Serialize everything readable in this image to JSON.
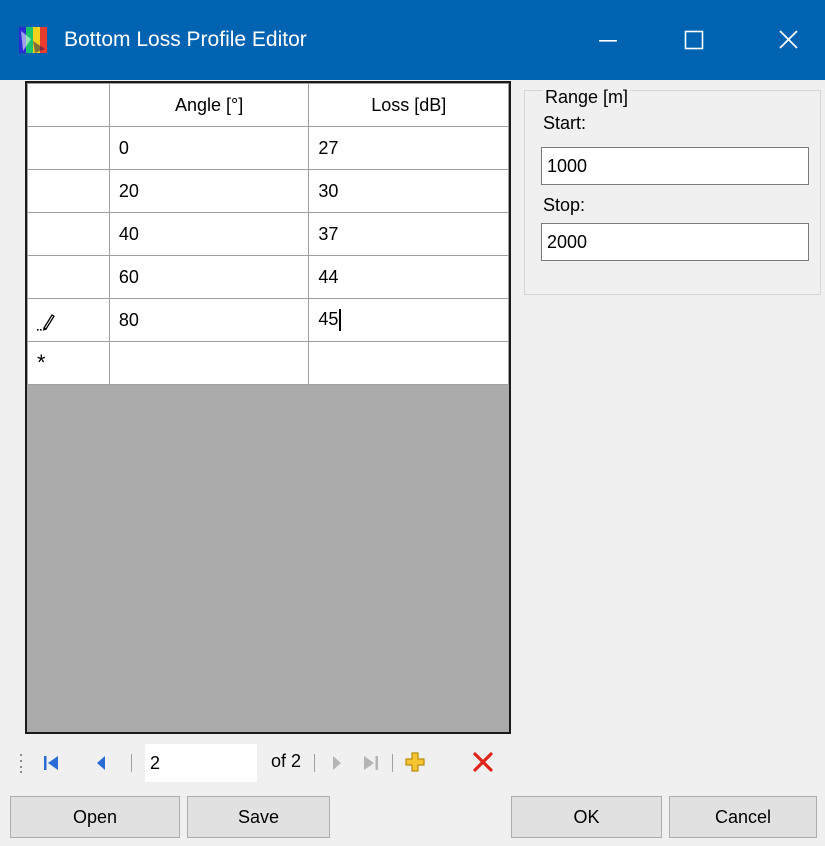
{
  "window": {
    "title": "Bottom Loss Profile Editor",
    "titlebar_color": "#0063b1",
    "controls": [
      "minimize-icon",
      "maximize-icon",
      "close-icon"
    ]
  },
  "grid": {
    "columns": [
      "Angle [°]",
      "Loss [dB]"
    ],
    "rows": [
      {
        "marker": "",
        "angle": "0",
        "loss": "27"
      },
      {
        "marker": "",
        "angle": "20",
        "loss": "30"
      },
      {
        "marker": "",
        "angle": "40",
        "loss": "37"
      },
      {
        "marker": "",
        "angle": "60",
        "loss": "44"
      },
      {
        "marker": "pencil-icon",
        "angle": "80",
        "loss": "45"
      }
    ],
    "new_row_marker": "*",
    "empty_area_color": "#ababab"
  },
  "range": {
    "legend": "Range [m]",
    "start_label": "Start:",
    "start_value": "1000",
    "stop_label": "Stop:",
    "stop_value": "2000"
  },
  "navigator": {
    "position": "2",
    "of_label": "of 2",
    "icons": [
      "move-first-icon",
      "move-previous-icon",
      "move-next-icon",
      "move-last-icon",
      "add-new-icon",
      "delete-icon"
    ]
  },
  "buttons": {
    "open": "Open",
    "save": "Save",
    "ok": "OK",
    "cancel": "Cancel"
  }
}
